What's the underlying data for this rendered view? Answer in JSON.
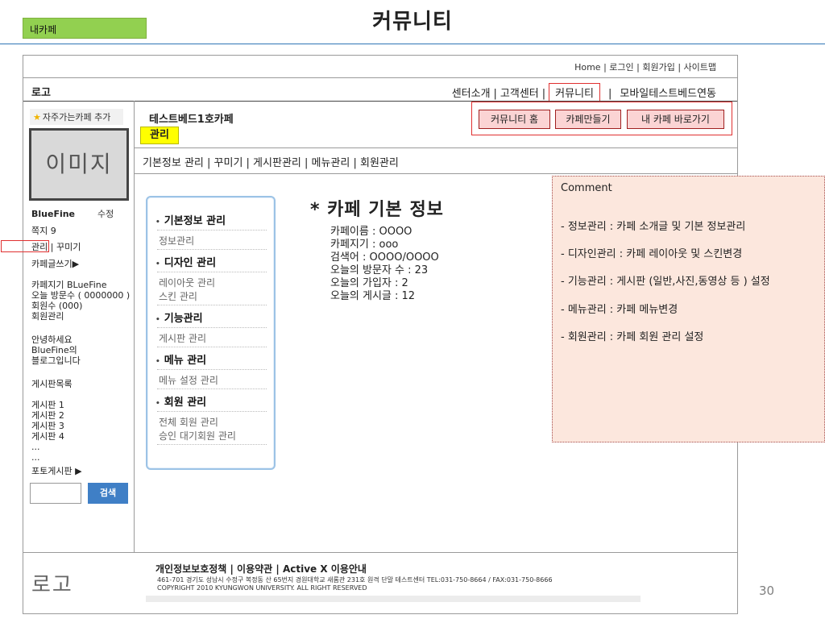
{
  "slide": {
    "tag": "내카페",
    "title": "커뮤니티",
    "page_number": "30"
  },
  "top_links": "Home | 로그인 | 회원가입 | 사이트맵",
  "logo_top": "로고",
  "main_nav": {
    "items": [
      "센터소개",
      "고객센터",
      "커뮤니티",
      "모바일테스트베드연동"
    ],
    "separators": [
      "|",
      "|",
      "|"
    ]
  },
  "sidebar": {
    "favorite": "자주가는카페 추가",
    "image_placeholder": "이미지",
    "user_name": "BlueFine",
    "edit": "수정",
    "messages": "쪽지 9",
    "admin_link": "관리",
    "decorate_link": "| 꾸미기",
    "write_post": "카페글쓰기▶",
    "stats": [
      "카페지기 BLueFine",
      "오늘 방문수 ( 0000000 )",
      "회원수 (000)",
      "회원관리"
    ],
    "greeting": [
      "안녕하세요",
      "BlueFine의",
      "블로그입니다"
    ],
    "boards_title": "게시판목록",
    "boards": [
      "게시판 1",
      "게시판 2",
      "게시판 3",
      "게시판 4",
      "...",
      "..."
    ],
    "photo_board": "포토게시판 ▶",
    "search_button": "검색"
  },
  "cafe": {
    "name": "테스트베드1호카페",
    "admin_tag": "관리"
  },
  "cafe_buttons": [
    "커뮤니티 홈",
    "카페만들기",
    "내 카페 바로가기"
  ],
  "sub_nav": "기본정보 관리 | 꾸미기 | 게시판관리 | 메뉴관리 | 회원관리",
  "admin_menu": {
    "basic": {
      "title": "기본정보 관리",
      "items": [
        "정보관리"
      ]
    },
    "design": {
      "title": "디자인 관리",
      "items": [
        "레이아웃 관리",
        "스킨 관리"
      ]
    },
    "function": {
      "title": "기능관리",
      "items": [
        "게시판 관리"
      ]
    },
    "menu": {
      "title": "메뉴 관리",
      "items": [
        "메뉴 설정 관리"
      ]
    },
    "member": {
      "title": "회원 관리",
      "items": [
        "전체 회원 관리",
        "승인 대기회원 관리"
      ]
    }
  },
  "cafe_info": {
    "title": "* 카페 기본 정보",
    "lines": [
      "카페이름 : OOOO",
      "카페지기 : ooo",
      "검색어 : OOOO/OOOO",
      "오늘의 방문자 수 : 23",
      "오늘의 가입자 : 2",
      "오늘의 게시글 : 12"
    ]
  },
  "comment": {
    "title": "Comment",
    "items": [
      "- 정보관리 : 카페 소개글 및 기본 정보관리",
      "- 디자인관리 : 카페 레이아웃 및 스킨변경",
      "- 기능관리 : 게시판 (일반,사진,동영상 등 ) 설정",
      "- 메뉴관리 : 카페 메뉴변경",
      "- 회원관리 : 카페 회원 관리 설정"
    ]
  },
  "footer": {
    "logo": "로고",
    "links": "개인정보보호정책 | 이용약관 | Active X 이용안내",
    "address": "461-701 경기도 성남시 수정구 복정동 산 65번지 경원대학교 새롬관 231호 원격 단말 테스트센터 TEL:031-750-8664 / FAX:031-750-8666",
    "copyright": "COPYRIGHT 2010 KYUNGWON UNIVERSITY. ALL RIGHT RESERVED"
  },
  "colors": {
    "tag_green": "#92d050",
    "highlight_red": "#e03030",
    "admin_yellow": "#ffff00",
    "button_pink": "#fbd4d4",
    "comment_bg": "#fce7dd",
    "search_blue": "#3f7fc6",
    "panel_border": "#9cc3e6"
  }
}
